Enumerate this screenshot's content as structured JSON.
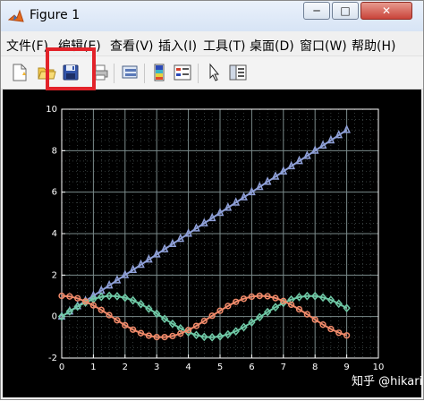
{
  "window": {
    "title": "Figure 1"
  },
  "titlebar": {
    "minimize_glyph": "─",
    "maximize_glyph": "□",
    "close_glyph": "✕"
  },
  "menu": [
    {
      "label": "文件(F)"
    },
    {
      "label": "编辑(E)"
    },
    {
      "label": "查看(V)"
    },
    {
      "label": "插入(I)"
    },
    {
      "label": "工具(T)"
    },
    {
      "label": "桌面(D)"
    },
    {
      "label": "窗口(W)"
    },
    {
      "label": "帮助(H)"
    }
  ],
  "toolbar": {
    "icons": [
      "new-figure-icon",
      "open-file-icon",
      "save-figure-icon",
      "print-figure-icon",
      "link-plot-icon",
      "insert-colorbar-icon",
      "insert-legend-icon",
      "edit-plot-arrow-icon",
      "show-plot-tools-icon"
    ]
  },
  "watermark": "知乎 @hikari",
  "colors": {
    "background": "#000000",
    "axes": "#ffffff",
    "grid": "#7a8a8a",
    "linear": "#8fa0d8",
    "sin": "#6fc9a6",
    "cos": "#f08a6a",
    "highlight": "#e2232a"
  },
  "chart_data": {
    "type": "line",
    "grid": true,
    "minor_grid": true,
    "xlim": [
      0,
      10
    ],
    "ylim": [
      -2,
      10
    ],
    "xticks": [
      0,
      1,
      2,
      3,
      4,
      5,
      6,
      7,
      8,
      9,
      10
    ],
    "yticks": [
      -2,
      0,
      2,
      4,
      6,
      8,
      10
    ],
    "title": "",
    "xlabel": "",
    "ylabel": "",
    "series": [
      {
        "marker": "triangle",
        "color": "#8fa0d8",
        "x": [
          0,
          0.25,
          0.5,
          0.75,
          1,
          1.25,
          1.5,
          1.75,
          2,
          2.25,
          2.5,
          2.75,
          3,
          3.25,
          3.5,
          3.75,
          4,
          4.25,
          4.5,
          4.75,
          5,
          5.25,
          5.5,
          5.75,
          6,
          6.25,
          6.5,
          6.75,
          7,
          7.25,
          7.5,
          7.75,
          8,
          8.25,
          8.5,
          8.75,
          9
        ],
        "y": [
          0,
          0.25,
          0.5,
          0.75,
          1,
          1.25,
          1.5,
          1.75,
          2,
          2.25,
          2.5,
          2.75,
          3,
          3.25,
          3.5,
          3.75,
          4,
          4.25,
          4.5,
          4.75,
          5,
          5.25,
          5.5,
          5.75,
          6,
          6.25,
          6.5,
          6.75,
          7,
          7.25,
          7.5,
          7.75,
          8,
          8.25,
          8.5,
          8.75,
          9
        ]
      },
      {
        "marker": "diamond",
        "color": "#6fc9a6",
        "x": [
          0,
          0.25,
          0.5,
          0.75,
          1,
          1.25,
          1.5,
          1.75,
          2,
          2.25,
          2.5,
          2.75,
          3,
          3.25,
          3.5,
          3.75,
          4,
          4.25,
          4.5,
          4.75,
          5,
          5.25,
          5.5,
          5.75,
          6,
          6.25,
          6.5,
          6.75,
          7,
          7.25,
          7.5,
          7.75,
          8,
          8.25,
          8.5,
          8.75,
          9
        ],
        "y": [
          0,
          0.25,
          0.48,
          0.68,
          0.84,
          0.95,
          1.0,
          0.98,
          0.91,
          0.78,
          0.6,
          0.38,
          0.14,
          -0.11,
          -0.35,
          -0.57,
          -0.76,
          -0.89,
          -0.98,
          -1.0,
          -0.96,
          -0.86,
          -0.71,
          -0.51,
          -0.28,
          -0.03,
          0.22,
          0.45,
          0.66,
          0.82,
          0.94,
          0.99,
          0.99,
          0.92,
          0.8,
          0.62,
          0.41
        ]
      },
      {
        "marker": "circle",
        "color": "#f08a6a",
        "x": [
          0,
          0.25,
          0.5,
          0.75,
          1,
          1.25,
          1.5,
          1.75,
          2,
          2.25,
          2.5,
          2.75,
          3,
          3.25,
          3.5,
          3.75,
          4,
          4.25,
          4.5,
          4.75,
          5,
          5.25,
          5.5,
          5.75,
          6,
          6.25,
          6.5,
          6.75,
          7,
          7.25,
          7.5,
          7.75,
          8,
          8.25,
          8.5,
          8.75,
          9
        ],
        "y": [
          1.0,
          0.97,
          0.88,
          0.73,
          0.54,
          0.32,
          0.07,
          -0.18,
          -0.42,
          -0.63,
          -0.8,
          -0.92,
          -0.99,
          -0.99,
          -0.94,
          -0.82,
          -0.65,
          -0.45,
          -0.21,
          0.04,
          0.28,
          0.51,
          0.71,
          0.86,
          0.96,
          1.0,
          0.98,
          0.89,
          0.75,
          0.57,
          0.35,
          0.11,
          -0.15,
          -0.39,
          -0.6,
          -0.78,
          -0.91
        ]
      }
    ]
  }
}
